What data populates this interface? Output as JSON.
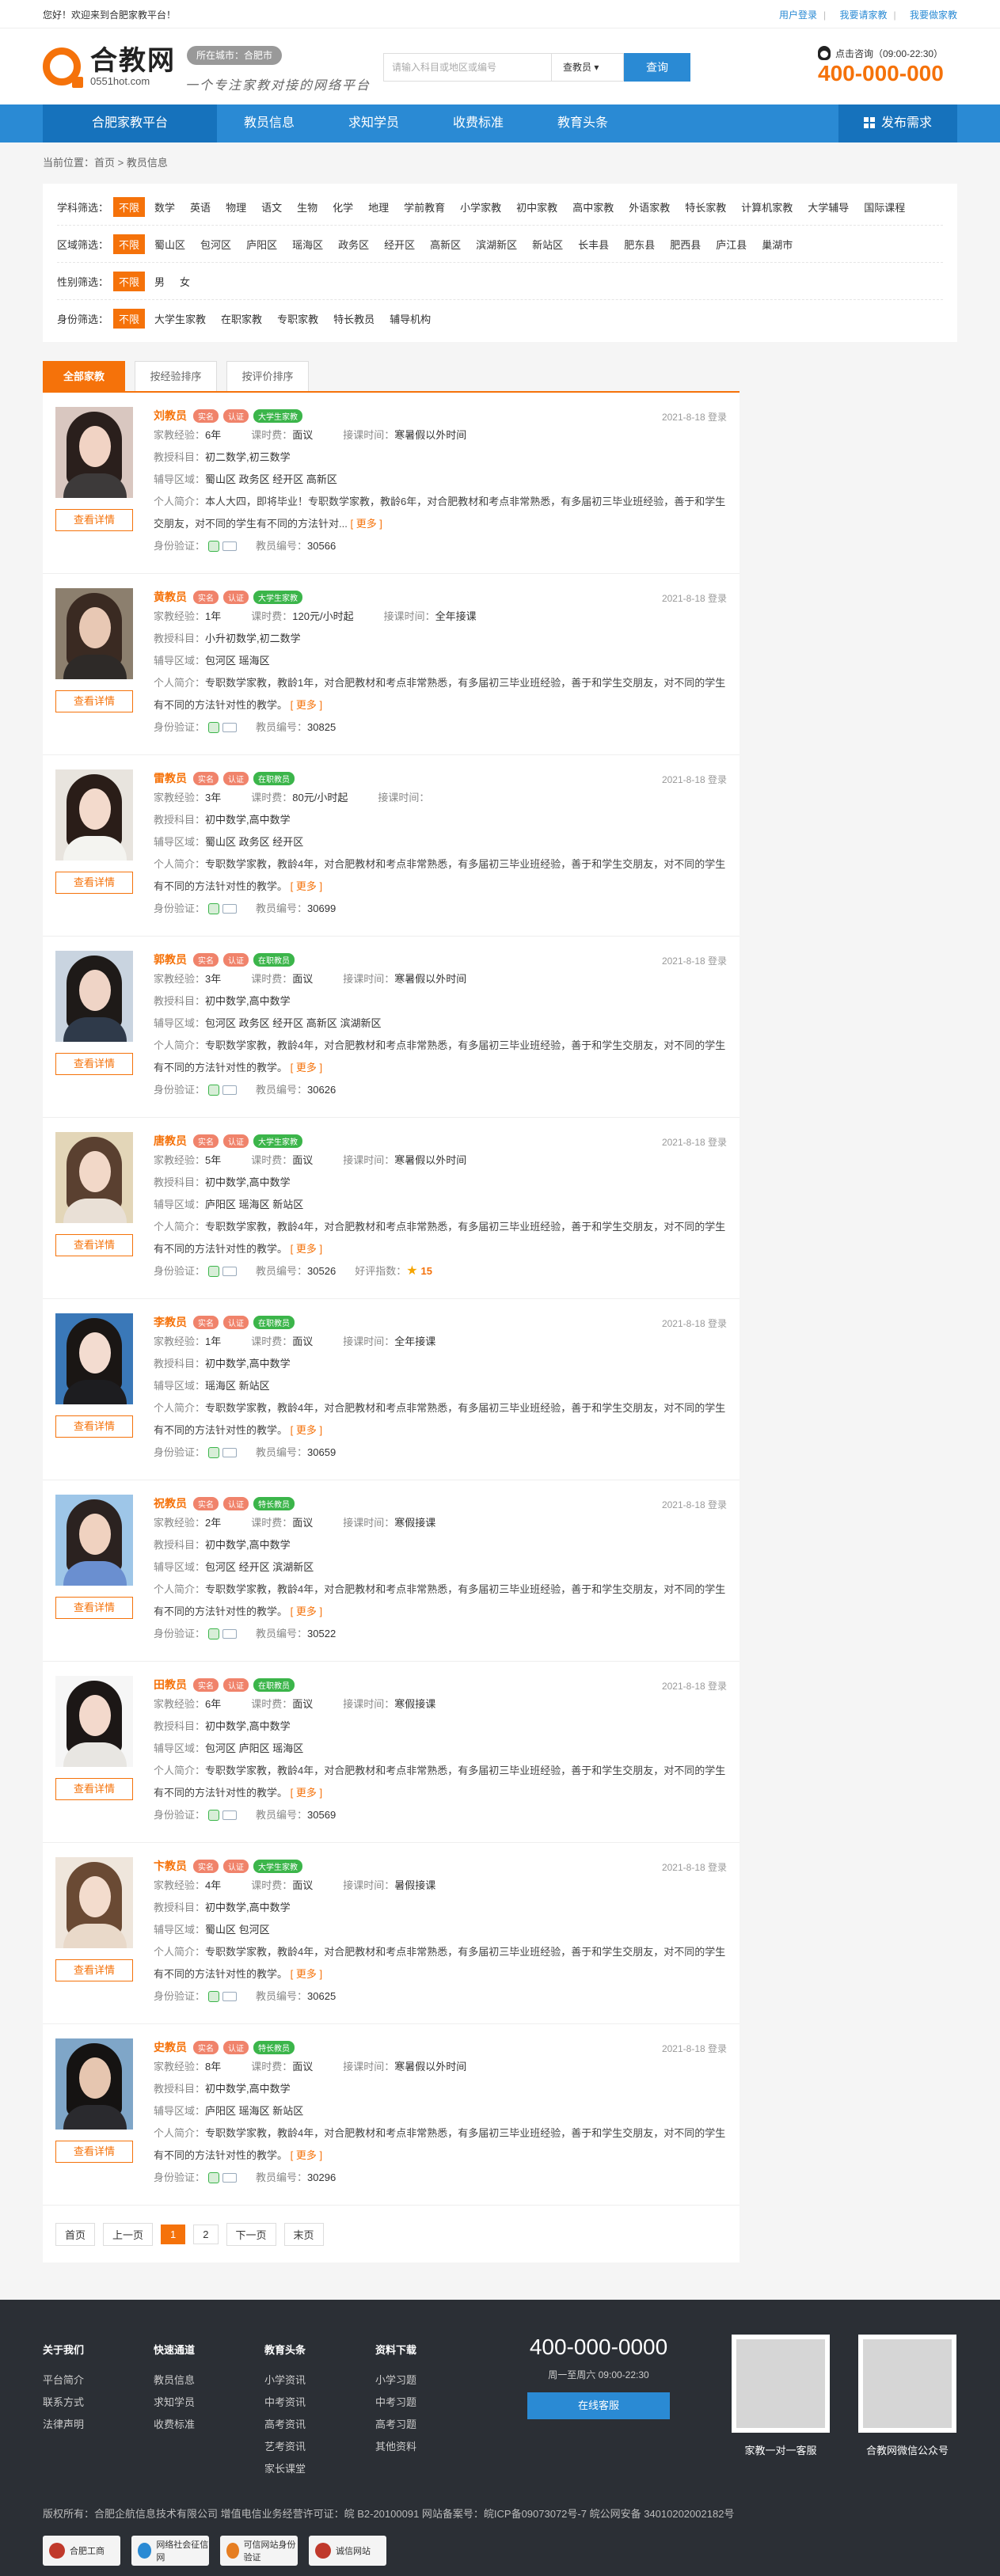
{
  "topbar": {
    "welcome": "您好！欢迎来到合肥家教平台！",
    "links": [
      "用户登录",
      "我要请家教",
      "我要做家教"
    ]
  },
  "header": {
    "logo_cn": "合教网",
    "logo_en": "0551hot.com",
    "city": "所在城市：合肥市",
    "slogan": "一个专注家教对接的网络平台",
    "search_placeholder": "请输入科目或地区或编号",
    "search_type": "查教员",
    "search_btn": "查询",
    "hotline_label": "点击咨询（09:00-22:30）",
    "hotline": "400-000-000"
  },
  "nav": {
    "items": [
      "合肥家教平台",
      "教员信息",
      "求知学员",
      "收费标准",
      "教育头条"
    ],
    "publish": "发布需求"
  },
  "crumb": "当前位置：首页 > 教员信息",
  "filters": [
    {
      "label": "学科筛选：",
      "options": [
        "不限",
        "数学",
        "英语",
        "物理",
        "语文",
        "生物",
        "化学",
        "地理",
        "学前教育",
        "小学家教",
        "初中家教",
        "高中家教",
        "外语家教",
        "特长家教",
        "计算机家教",
        "大学辅导",
        "国际课程"
      ]
    },
    {
      "label": "区域筛选：",
      "options": [
        "不限",
        "蜀山区",
        "包河区",
        "庐阳区",
        "瑶海区",
        "政务区",
        "经开区",
        "高新区",
        "滨湖新区",
        "新站区",
        "长丰县",
        "肥东县",
        "肥西县",
        "庐江县",
        "巢湖市"
      ]
    },
    {
      "label": "性别筛选：",
      "options": [
        "不限",
        "男",
        "女"
      ]
    },
    {
      "label": "身份筛选：",
      "options": [
        "不限",
        "大学生家教",
        "在职家教",
        "专职家教",
        "特长教员",
        "辅导机构"
      ]
    }
  ],
  "tabs": [
    "全部家教",
    "按经验排序",
    "按评价排序"
  ],
  "labels": {
    "exp": "家教经验：",
    "fee": "课时费：",
    "time": "接课时间：",
    "subject": "教授科目：",
    "area": "辅导区域：",
    "intro": "个人简介：",
    "verify": "身份验证：",
    "id": "教员编号：",
    "detail": "查看详情",
    "more": "[ 更多 ]",
    "score": "好评指数："
  },
  "teachers": [
    {
      "name": "刘教员",
      "tags": [
        "实名",
        "认证"
      ],
      "type": "大学生家教",
      "date": "2021-8-18 登录",
      "exp": "6年",
      "fee": "面议",
      "time": "寒暑假以外时间",
      "subject": "初二数学,初三数学",
      "area": "蜀山区 政务区 经开区 高新区",
      "intro": "本人大四，即将毕业！专职数学家教，教龄6年，对合肥教材和考点非常熟悉，有多届初三毕业班经验，善于和学生交朋友，对不同的学生有不同的方法针对...",
      "id": "30566",
      "score": "",
      "colors": [
        "#2a1f1c",
        "#f1d3c4",
        "#3d3a3a",
        "#d9c7c0"
      ]
    },
    {
      "name": "黄教员",
      "tags": [
        "实名",
        "认证"
      ],
      "type": "大学生家教",
      "date": "2021-8-18 登录",
      "exp": "1年",
      "fee": "120元/小时起",
      "time": "全年接课",
      "subject": "小升初数学,初二数学",
      "area": "包河区 瑶海区",
      "intro": "专职数学家教，教龄1年，对合肥教材和考点非常熟悉，有多届初三毕业班经验，善于和学生交朋友，对不同的学生有不同的方法针对性的教学。",
      "id": "30825",
      "score": "",
      "colors": [
        "#3a2a22",
        "#e8c8b4",
        "#2e2a28",
        "#8c7f6e"
      ]
    },
    {
      "name": "雷教员",
      "tags": [
        "实名",
        "认证"
      ],
      "type": "在职教员",
      "date": "2021-8-18 登录",
      "exp": "3年",
      "fee": "80元/小时起",
      "time": "",
      "subject": "初中数学,高中数学",
      "area": "蜀山区 政务区 经开区",
      "intro": "专职数学家教，教龄4年，对合肥教材和考点非常熟悉，有多届初三毕业班经验，善于和学生交朋友，对不同的学生有不同的方法针对性的教学。",
      "id": "30699",
      "score": "",
      "colors": [
        "#2a1d18",
        "#f3dacc",
        "#f4f4f0",
        "#e8e4de"
      ]
    },
    {
      "name": "郭教员",
      "tags": [
        "实名",
        "认证"
      ],
      "type": "在职教员",
      "date": "2021-8-18 登录",
      "exp": "3年",
      "fee": "面议",
      "time": "寒暑假以外时间",
      "subject": "初中数学,高中数学",
      "area": "包河区 政务区 经开区 高新区 滨湖新区",
      "intro": "专职数学家教，教龄4年，对合肥教材和考点非常熟悉，有多届初三毕业班经验，善于和学生交朋友，对不同的学生有不同的方法针对性的教学。",
      "id": "30626",
      "score": "",
      "colors": [
        "#1e1a18",
        "#efd4c6",
        "#2f3a4a",
        "#c9d4e0"
      ]
    },
    {
      "name": "唐教员",
      "tags": [
        "实名",
        "认证"
      ],
      "type": "大学生家教",
      "date": "2021-8-18 登录",
      "exp": "5年",
      "fee": "面议",
      "time": "寒暑假以外时间",
      "subject": "初中数学,高中数学",
      "area": "庐阳区 瑶海区 新站区",
      "intro": "专职数学家教，教龄4年，对合肥教材和考点非常熟悉，有多届初三毕业班经验，善于和学生交朋友，对不同的学生有不同的方法针对性的教学。",
      "id": "30526",
      "score": "15",
      "colors": [
        "#5a4030",
        "#f2d8c8",
        "#e9e0d6",
        "#e3d6b8"
      ]
    },
    {
      "name": "李教员",
      "tags": [
        "实名",
        "认证"
      ],
      "type": "在职教员",
      "date": "2021-8-18 登录",
      "exp": "1年",
      "fee": "面议",
      "time": "全年接课",
      "subject": "初中数学,高中数学",
      "area": "瑶海区 新站区",
      "intro": "专职数学家教，教龄4年，对合肥教材和考点非常熟悉，有多届初三毕业班经验，善于和学生交朋友，对不同的学生有不同的方法针对性的教学。",
      "id": "30659",
      "score": "",
      "colors": [
        "#1a1614",
        "#f3dcd0",
        "#1d1d20",
        "#3a78b8"
      ]
    },
    {
      "name": "祝教员",
      "tags": [
        "实名",
        "认证"
      ],
      "type": "特长教员",
      "date": "2021-8-18 登录",
      "exp": "2年",
      "fee": "面议",
      "time": "寒假接课",
      "subject": "初中数学,高中数学",
      "area": "包河区 经开区 滨湖新区",
      "intro": "专职数学家教，教龄4年，对合肥教材和考点非常熟悉，有多届初三毕业班经验，善于和学生交朋友，对不同的学生有不同的方法针对性的教学。",
      "id": "30522",
      "score": "",
      "colors": [
        "#2b2220",
        "#f0d2c0",
        "#6a8fd0",
        "#9ec6e8"
      ]
    },
    {
      "name": "田教员",
      "tags": [
        "实名",
        "认证"
      ],
      "type": "在职教员",
      "date": "2021-8-18 登录",
      "exp": "6年",
      "fee": "面议",
      "time": "寒假接课",
      "subject": "初中数学,高中数学",
      "area": "包河区 庐阳区 瑶海区",
      "intro": "专职数学家教，教龄4年，对合肥教材和考点非常熟悉，有多届初三毕业班经验，善于和学生交朋友，对不同的学生有不同的方法针对性的教学。",
      "id": "30569",
      "score": "",
      "colors": [
        "#1c1716",
        "#f3d9cc",
        "#e8e6e2",
        "#f6f6f6"
      ]
    },
    {
      "name": "卞教员",
      "tags": [
        "实名",
        "认证"
      ],
      "type": "大学生家教",
      "date": "2021-8-18 登录",
      "exp": "4年",
      "fee": "面议",
      "time": "暑假接课",
      "subject": "初中数学,高中数学",
      "area": "蜀山区 包河区",
      "intro": "专职数学家教，教龄4年，对合肥教材和考点非常熟悉，有多届初三毕业班经验，善于和学生交朋友，对不同的学生有不同的方法针对性的教学。",
      "id": "30625",
      "score": "",
      "colors": [
        "#6a4a34",
        "#f3dccd",
        "#e9d9c9",
        "#efe6dc"
      ]
    },
    {
      "name": "史教员",
      "tags": [
        "实名",
        "认证"
      ],
      "type": "特长教员",
      "date": "2021-8-18 登录",
      "exp": "8年",
      "fee": "面议",
      "time": "寒暑假以外时间",
      "subject": "初中数学,高中数学",
      "area": "庐阳区 瑶海区 新站区",
      "intro": "专职数学家教，教龄4年，对合肥教材和考点非常熟悉，有多届初三毕业班经验，善于和学生交朋友，对不同的学生有不同的方法针对性的教学。",
      "id": "30296",
      "score": "",
      "colors": [
        "#151312",
        "#e6c6b0",
        "#2a2a2e",
        "#7fa6c8"
      ]
    }
  ],
  "pager": [
    "首页",
    "上一页",
    "1",
    "2",
    "下一页",
    "末页"
  ],
  "footer": {
    "cols": [
      {
        "title": "关于我们",
        "items": [
          "平台简介",
          "联系方式",
          "法律声明"
        ]
      },
      {
        "title": "快速通道",
        "items": [
          "教员信息",
          "求知学员",
          "收费标准"
        ]
      },
      {
        "title": "教育头条",
        "items": [
          "小学资讯",
          "中考资讯",
          "高考资讯",
          "艺考资讯",
          "家长课堂"
        ]
      },
      {
        "title": "资料下载",
        "items": [
          "小学习题",
          "中考习题",
          "高考习题",
          "其他资料"
        ]
      }
    ],
    "phone": "400-000-0000",
    "hours": "周一至周六 09:00-22:30",
    "service": "在线客服",
    "qr1": "家教一对一客服",
    "qr2": "合教网微信公众号",
    "copyright": "版权所有：合肥企航信息技术有限公司 增值电信业务经营许可证：皖 B2-20100091 网站备案号：皖ICP备09073072号-7 皖公网安备 34010202002182号",
    "badges": [
      "合肥工商",
      "网络社会征信网",
      "可信网站身份验证",
      "诚信网站"
    ]
  }
}
